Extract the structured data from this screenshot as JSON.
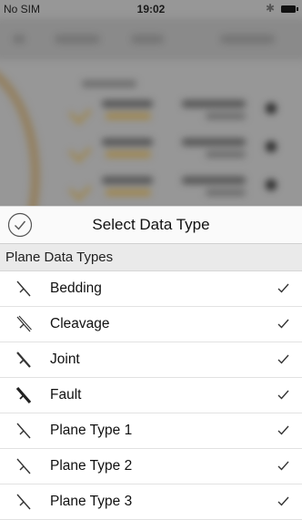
{
  "status_bar": {
    "carrier": "No SIM",
    "time": "19:02",
    "bluetooth_icon": "bluetooth-icon",
    "battery_icon": "battery-icon"
  },
  "sheet": {
    "title": "Select Data Type",
    "done_icon": "checkmark-circle-icon",
    "section_title": "Plane Data Types",
    "items": [
      {
        "label": "Bedding",
        "checked": true
      },
      {
        "label": "Cleavage",
        "checked": true
      },
      {
        "label": "Joint",
        "checked": true
      },
      {
        "label": "Fault",
        "checked": true
      },
      {
        "label": "Plane Type 1",
        "checked": true
      },
      {
        "label": "Plane Type 2",
        "checked": true
      },
      {
        "label": "Plane Type 3",
        "checked": true
      }
    ]
  },
  "colors": {
    "sheet_background": "#ffffff",
    "section_background": "#eaeaea",
    "check_color": "#333333"
  }
}
